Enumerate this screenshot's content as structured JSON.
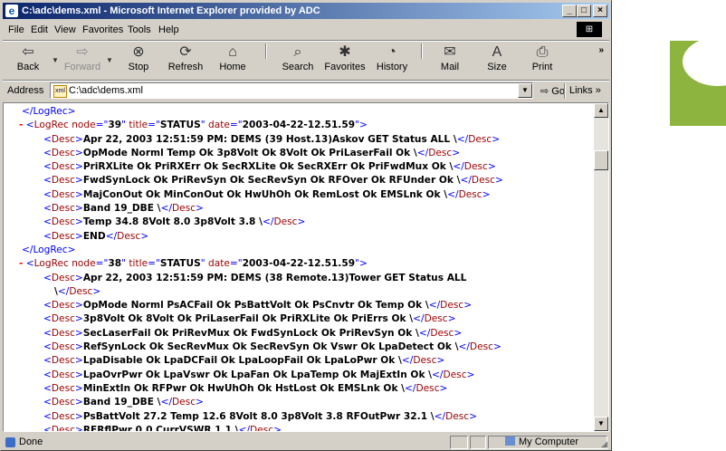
{
  "window": {
    "title": "C:\\adc\\dems.xml - Microsoft Internet Explorer provided by ADC"
  },
  "menu": [
    "File",
    "Edit",
    "View",
    "Favorites",
    "Tools",
    "Help"
  ],
  "toolbar": {
    "back": "Back",
    "forward": "Forward",
    "stop": "Stop",
    "refresh": "Refresh",
    "home": "Home",
    "search": "Search",
    "favorites": "Favorites",
    "history": "History",
    "mail": "Mail",
    "size": "Size",
    "print": "Print"
  },
  "address": {
    "label": "Address",
    "value": "C:\\adc\\dems.xml",
    "go": "Go",
    "links": "Links"
  },
  "xml": {
    "close_logrec": "</LogRec>",
    "rec39": {
      "node": "39",
      "title": "STATUS",
      "date": "2003-04-22-12.51.59",
      "descs": [
        "Apr 22, 2003 12:51:59 PM: DEMS (39 Host.13)Askov GET Status ALL \\",
        "OpMode Norml Temp Ok 3p8Volt Ok 8Volt Ok PriLaserFail Ok \\",
        "PriRXLite Ok PriRXErr Ok SecRXLite Ok SecRXErr Ok PriFwdMux Ok \\",
        "FwdSynLock Ok PriRevSyn Ok SecRevSyn Ok RFOver Ok RFUnder Ok \\",
        "MajConOut Ok MinConOut Ok HwUhOh Ok RemLost Ok EMSLnk Ok \\",
        "Band 19_DBE \\",
        "Temp 34.8 8Volt 8.0 3p8Volt 3.8 \\",
        "END"
      ]
    },
    "rec38": {
      "node": "38",
      "title": "STATUS",
      "date": "2003-04-22-12.51.59",
      "first_desc_line1": "Apr 22, 2003 12:51:59 PM: DEMS (38 Remote.13)Tower GET Status ALL",
      "first_desc_line2": "\\",
      "descs": [
        "OpMode Norml PsACFail Ok PsBattVolt Ok PsCnvtr Ok Temp Ok \\",
        "3p8Volt Ok 8Volt Ok PriLaserFail Ok PriRXLite Ok PriErrs Ok \\",
        "SecLaserFail Ok PriRevMux Ok FwdSynLock Ok PriRevSyn Ok \\",
        "RefSynLock Ok SecRevMux Ok SecRevSyn Ok Vswr Ok LpaDetect Ok \\",
        "LpaDisable Ok LpaDCFail Ok LpaLoopFail Ok LpaLoPwr Ok \\",
        "LpaOvrPwr Ok LpaVswr Ok LpaFan Ok LpaTemp Ok MajExtIn Ok \\",
        "MinExtIn Ok RFPwr Ok HwUhOh Ok HstLost Ok EMSLnk Ok \\",
        "Band 19_DBE \\",
        "PsBattVolt 27.2 Temp 12.6 8Volt 8.0 3p8Volt 3.8 RFOutPwr 32.1 \\",
        "RFRflPwr 0.0 CurrVSWR 1.1 \\"
      ]
    }
  },
  "status": {
    "text": "Done",
    "zone": "My Computer"
  }
}
